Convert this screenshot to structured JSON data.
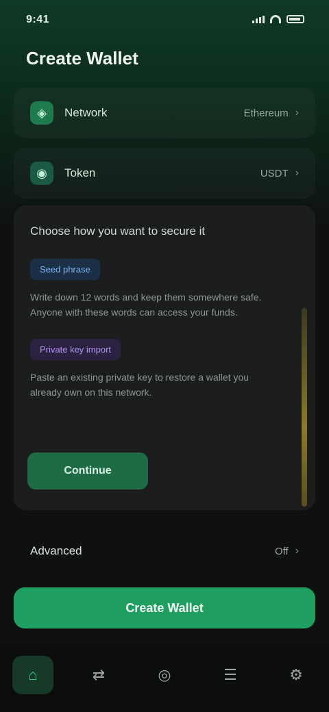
{
  "status": {
    "time": "9:41"
  },
  "header": {
    "title": "Create Wallet"
  },
  "rows": [
    {
      "label": "Network",
      "value": "Ethereum",
      "icon": "network-icon"
    },
    {
      "label": "Token",
      "value": "USDT",
      "icon": "token-icon"
    }
  ],
  "card": {
    "heading": "Choose how you want to secure it",
    "tag1": "Seed phrase",
    "para1": "Write down 12 words and keep them somewhere safe. Anyone with these words can access your funds.",
    "tag2": "Private key import",
    "para2": "Paste an existing private key to restore a wallet you already own on this network.",
    "cta": "Continue"
  },
  "advanced": {
    "label": "Advanced",
    "value": "Off"
  },
  "main_button": {
    "label": "Create Wallet"
  },
  "nav": {
    "items": [
      {
        "name": "home",
        "icon": "⌂"
      },
      {
        "name": "swap",
        "icon": "⇄"
      },
      {
        "name": "scan",
        "icon": "◎"
      },
      {
        "name": "history",
        "icon": "☰"
      },
      {
        "name": "settings",
        "icon": "⚙"
      }
    ]
  },
  "colors": {
    "accent": "#1e9f5f",
    "card": "#1b1e1c",
    "blue_tag": "#7fb2f0",
    "purple_tag": "#b391f0"
  }
}
